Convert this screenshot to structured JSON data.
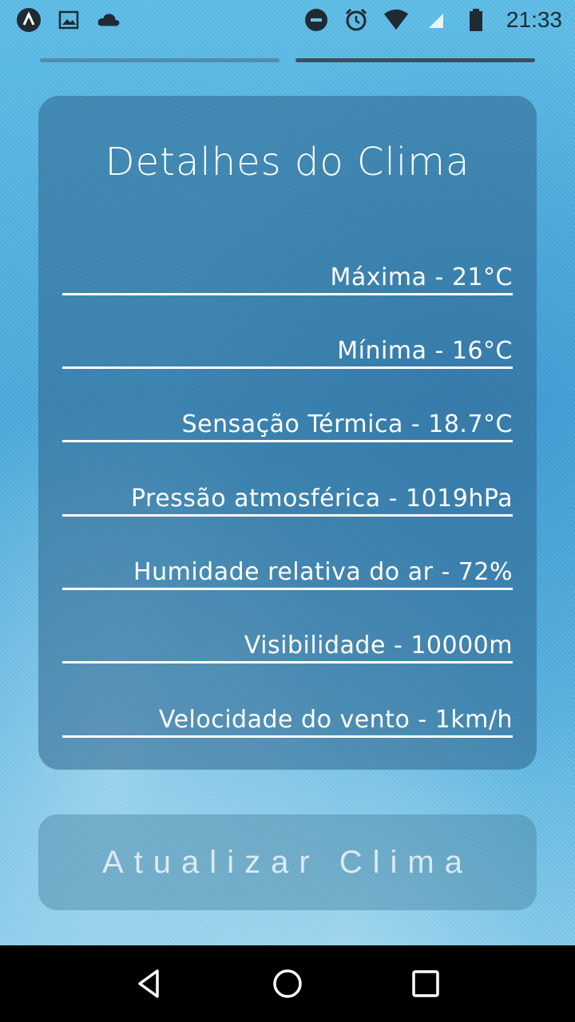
{
  "status_bar": {
    "time": "21:33",
    "left_icons": [
      "app-a-icon",
      "image-icon",
      "cloud-icon"
    ],
    "right_icons": [
      "do-not-disturb-icon",
      "alarm-icon",
      "wifi-icon",
      "signal-icon",
      "battery-icon"
    ]
  },
  "pager": {
    "pages": 2,
    "active_index": 1
  },
  "card": {
    "title": "Detalhes do Clima",
    "rows": [
      {
        "text": "Máxima - 21°C"
      },
      {
        "text": "Mínima - 16°C"
      },
      {
        "text": "Sensação Térmica - 18.7°C"
      },
      {
        "text": "Pressão atmosférica - 1019hPa"
      },
      {
        "text": "Humidade relativa do ar - 72%"
      },
      {
        "text": "Visibilidade - 10000m"
      },
      {
        "text": "Velocidade do vento - 1km/h"
      }
    ]
  },
  "button": {
    "label": "Atualizar Clima"
  },
  "nav_bar": {
    "icons": [
      "back-icon",
      "home-icon",
      "recents-icon"
    ]
  },
  "colors": {
    "background": "#4aa9dc",
    "card": "#2d648c",
    "text": "#ffffff",
    "nav_bar": "#000000"
  }
}
